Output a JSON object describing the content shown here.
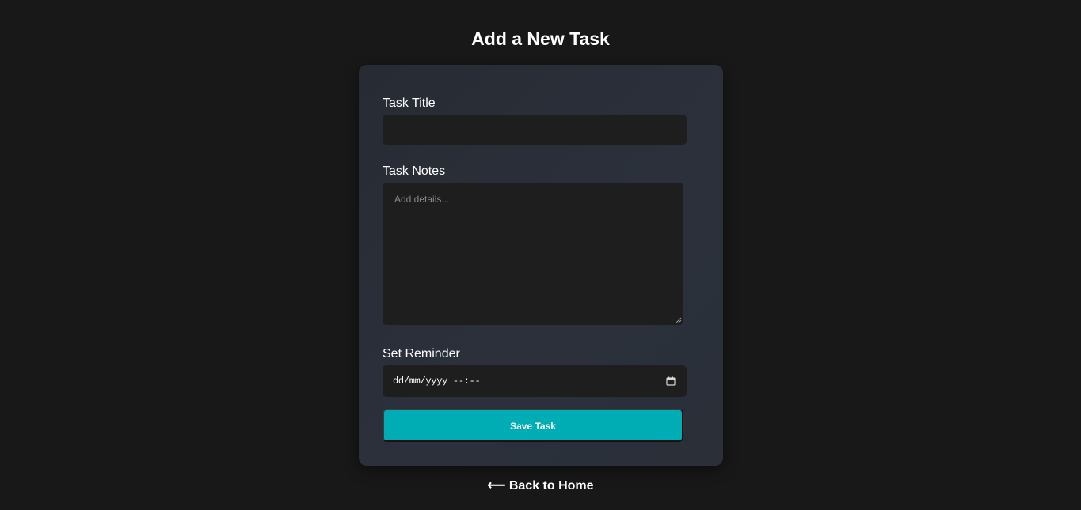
{
  "page": {
    "title": "Add a New Task"
  },
  "form": {
    "title_label": "Task Title",
    "title_value": "",
    "notes_label": "Task Notes",
    "notes_placeholder": "Add details...",
    "reminder_label": "Set Reminder",
    "reminder_value": "dd/mm/yyyy --:--",
    "save_label": "Save Task"
  },
  "nav": {
    "back_arrow": "⟵",
    "back_label": "Back to Home"
  },
  "colors": {
    "background": "#181818",
    "card": "#2a2f38",
    "input": "#1e1e1e",
    "accent": "#00adb5"
  },
  "icons": {
    "calendar": "calendar-icon",
    "back": "arrow-left-icon",
    "resize": "resize-grip-icon"
  }
}
